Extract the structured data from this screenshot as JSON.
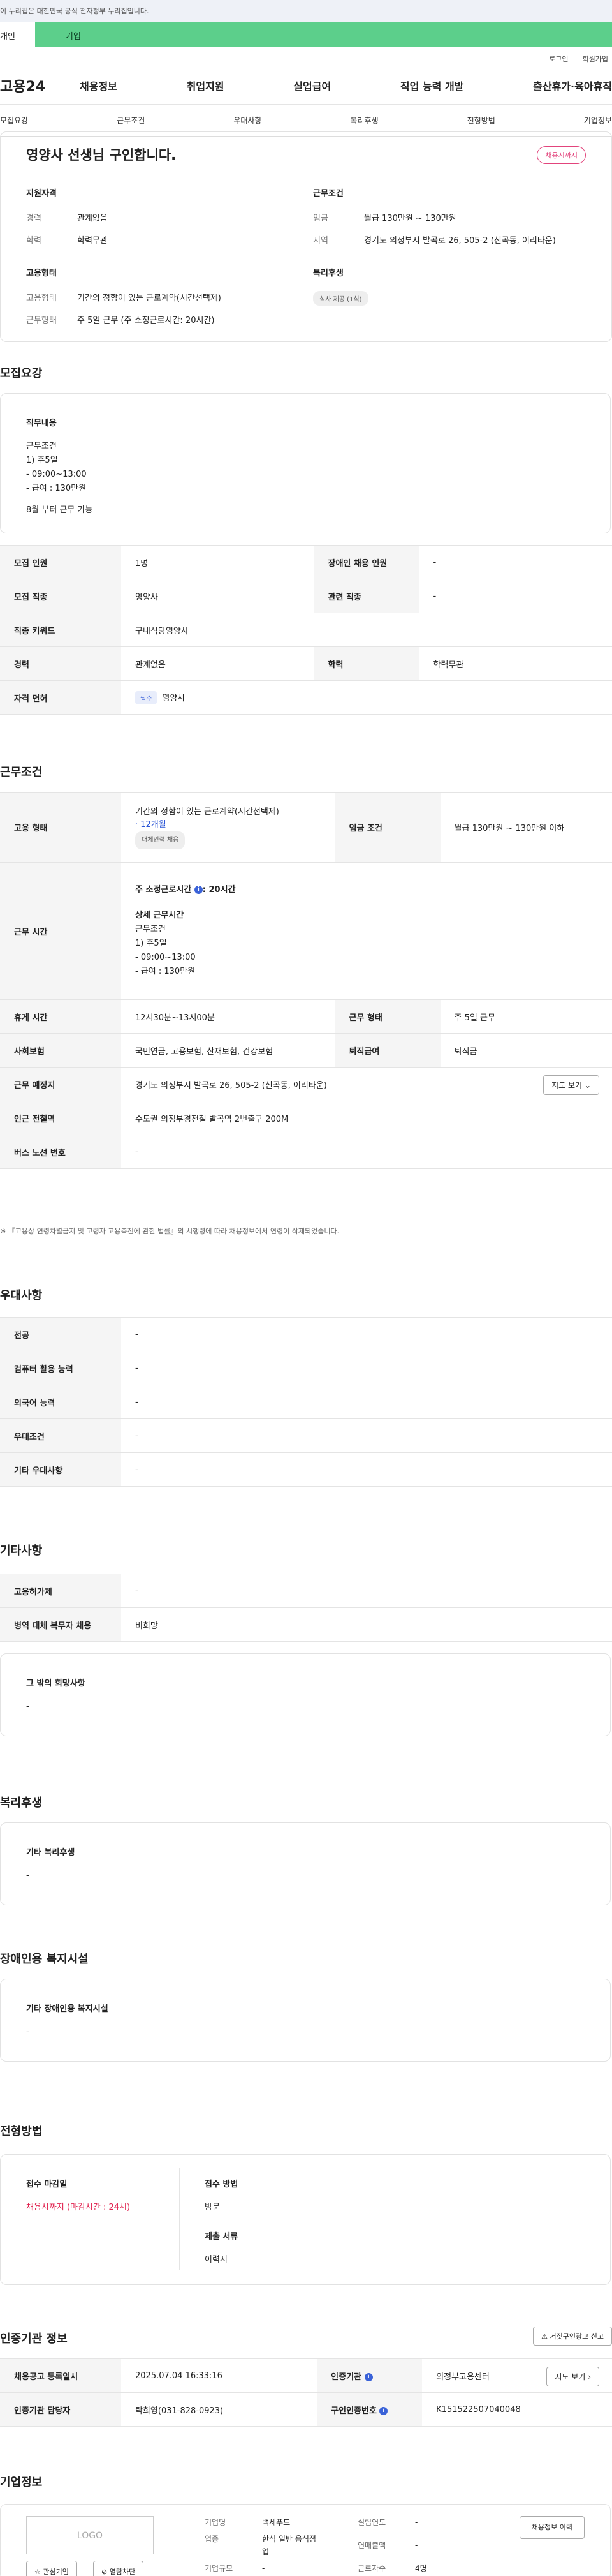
{
  "gov_banner": "이 누리집은 대한민국 공식 전자정부 누리집입니다.",
  "top_tabs": {
    "individual": "개인",
    "corporate": "기업"
  },
  "util": {
    "login": "로그인",
    "join": "회원가입"
  },
  "logo": "고용24",
  "gnb": [
    "채용정보",
    "취업지원",
    "실업급여",
    "직업 능력 개발",
    "출산휴가·육아휴직"
  ],
  "subnav": [
    "모집요강",
    "근무조건",
    "우대사항",
    "복리후생",
    "전형방법",
    "기업정보"
  ],
  "summary": {
    "title": "영양사 선생님 구인합니다.",
    "deadline_badge": "채용시까지",
    "qual": {
      "heading": "지원자격",
      "career_k": "경력",
      "career_v": "관계없음",
      "edu_k": "학력",
      "edu_v": "학력무관"
    },
    "cond": {
      "heading": "근무조건",
      "wage_k": "임금",
      "wage_v": "월급 130만원 ~ 130만원",
      "region_k": "지역",
      "region_v": "경기도 의정부시 발곡로 26, 505-2 (신곡동, 이리타운)"
    },
    "emp": {
      "heading": "고용형태",
      "type_k": "고용형태",
      "type_v": "기간의 정함이 있는 근로계약(시간선택제)",
      "work_k": "근무형태",
      "work_v": "주 5일 근무 (주 소정근로시간: 20시간)"
    },
    "welfare": {
      "heading": "복리후생",
      "badge": "식사 제공 (1식)"
    }
  },
  "recruit": {
    "title": "모집요강",
    "duty_heading": "직무내용",
    "duty_lines": [
      "근무조건",
      "1) 주5일",
      "- 09:00~13:00",
      "- 급여 : 130만원",
      "",
      "8월 부터 근무 가능"
    ],
    "rows": {
      "count_k": "모집 인원",
      "count_v": "1명",
      "disabled_k": "장애인 채용 인원",
      "disabled_v": "-",
      "job_k": "모집 직종",
      "job_v": "영양사",
      "related_k": "관련 직종",
      "related_v": "-",
      "kw_k": "직종 키워드",
      "kw_v": "구내식당영양사",
      "career_k": "경력",
      "career_v": "관계없음",
      "edu_k": "학력",
      "edu_v": "학력무관",
      "license_k": "자격 면허",
      "license_tag": "필수",
      "license_v": "영양사"
    }
  },
  "work": {
    "title": "근무조건",
    "emp_k": "고용 형태",
    "emp_v": "기간의 정함이 있는 근로계약(시간선택제)",
    "emp_period": "· 12개월",
    "emp_badge": "대체인력 채용",
    "wage_k": "임금 조건",
    "wage_v": "월급 130만원 ~ 130만원 이하",
    "hours_k": "근무 시간",
    "hours_main": "주 소정근로시간",
    "hours_value": ": 20시간",
    "hours_detail_h": "상세 근무시간",
    "hours_lines": [
      "근무조건",
      "1) 주5일",
      "- 09:00~13:00",
      "- 급여 : 130만원"
    ],
    "rest_k": "휴게 시간",
    "rest_v": "12시30분~13시00분",
    "form_k": "근무 형태",
    "form_v": "주 5일 근무",
    "ins_k": "사회보험",
    "ins_v": "국민연금, 고용보험, 산재보험, 건강보험",
    "sev_k": "퇴직급여",
    "sev_v": "퇴직금",
    "place_k": "근무 예정지",
    "place_v": "경기도 의정부시 발곡로 26, 505-2 (신곡동, 이리타운)",
    "map_btn": "지도 보기",
    "subway_k": "인근 전철역",
    "subway_v": "수도권 의정부경전철 발곡역 2번출구 200M",
    "bus_k": "버스 노선 번호",
    "bus_v": "-",
    "note": "※ 『고용상 연령차별금지 및 고령자 고용촉진에 관한 법률』의 시행령에 따라 채용정보에서 연령이 삭제되었습니다."
  },
  "pref": {
    "title": "우대사항",
    "rows": [
      [
        "전공",
        "-"
      ],
      [
        "컴퓨터 활용 능력",
        "-"
      ],
      [
        "외국어 능력",
        "-"
      ],
      [
        "우대조건",
        "-"
      ],
      [
        "기타 우대사항",
        "-"
      ]
    ]
  },
  "etc": {
    "title": "기타사항",
    "rows": [
      [
        "고용허가제",
        "-"
      ],
      [
        "병역 대체 복무자 채용",
        "비희망"
      ]
    ],
    "other_h": "그 밖의 희망사항",
    "other_v": "-"
  },
  "benefit": {
    "title": "복리후생",
    "h": "기타 복리후생",
    "v": "-"
  },
  "facility": {
    "title": "장애인용 복지시설",
    "h": "기타 장애인용 복지시설",
    "v": "-"
  },
  "process": {
    "title": "전형방법",
    "deadline_h": "접수 마감일",
    "deadline_v": "채용시까지 (마감시간 : 24시)",
    "method_h": "접수 방법",
    "method_v": "방문",
    "docs_h": "제출 서류",
    "docs_v": "이력서"
  },
  "cert": {
    "title": "인증기관 정보",
    "report_btn": "거짓구인광고 신고",
    "reg_k": "채용공고 등록일시",
    "reg_v": "2025.07.04 16:33:16",
    "org_k": "인증기관",
    "org_v": "의정부고용센터",
    "map_btn": "지도 보기",
    "mgr_k": "인증기관 담당자",
    "mgr_v": "탁희영(031-828-0923)",
    "num_k": "구인인증번호",
    "num_v": "K151522507040048"
  },
  "company": {
    "title": "기업정보",
    "logo": "LOGO",
    "fav_btn": "관심기업",
    "block_btn": "열람차단",
    "history_btn": "채용정보 이력",
    "name_k": "기업명",
    "name_v": "백세푸드",
    "ind_k": "업종",
    "ind_v1": "한식 일반 음식점",
    "ind_v2": "업",
    "size_k": "기업규모",
    "size_v": "-",
    "year_k": "설립연도",
    "year_v": "-",
    "sales_k": "연매출액",
    "sales_v": "-",
    "emp_k": "근로자수",
    "emp_v": "4명"
  }
}
